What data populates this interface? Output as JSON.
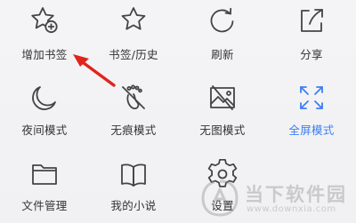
{
  "menu": {
    "items": [
      {
        "label": "增加书签",
        "icon": "star-plus-icon"
      },
      {
        "label": "书签/历史",
        "icon": "star-icon"
      },
      {
        "label": "刷新",
        "icon": "refresh-icon"
      },
      {
        "label": "分享",
        "icon": "share-icon"
      },
      {
        "label": "夜间模式",
        "icon": "moon-icon"
      },
      {
        "label": "无痕模式",
        "icon": "footprint-off-icon"
      },
      {
        "label": "无图模式",
        "icon": "image-off-icon"
      },
      {
        "label": "全屏模式",
        "icon": "fullscreen-icon",
        "active": true
      },
      {
        "label": "文件管理",
        "icon": "folder-icon"
      },
      {
        "label": "我的小说",
        "icon": "book-icon"
      },
      {
        "label": "设置",
        "icon": "gear-icon"
      }
    ]
  },
  "annotation": {
    "arrow_color": "#e0241c",
    "points_to": "增加书签"
  },
  "watermark": {
    "title": "当下软件园",
    "url": "www.downxia.com"
  },
  "colors": {
    "accent": "#3b7ff3",
    "icon": "#444444",
    "text": "#333333"
  }
}
